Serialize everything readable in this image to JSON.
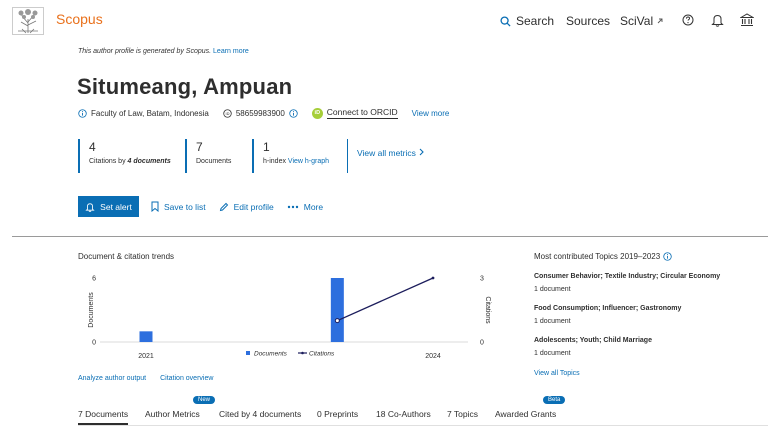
{
  "header": {
    "brand": "Scopus",
    "nav": {
      "search": "Search",
      "sources": "Sources",
      "scival": "SciVal"
    },
    "icons": [
      "elsevier-tree-icon",
      "search-icon",
      "external-link-icon",
      "help-icon",
      "bell-icon",
      "institution-icon"
    ]
  },
  "notice": {
    "text": "This author profile is generated by Scopus.",
    "link": "Learn more"
  },
  "author": {
    "name": "Situmeang, Ampuan",
    "affiliation": "Faculty of Law, Batam, Indonesia",
    "scopus_id": "58659983900",
    "orcid_label": "Connect to ORCID",
    "orcid_badge": "iD",
    "view_more": "View more"
  },
  "metrics": {
    "citations": {
      "value": "4",
      "label": "Citations by",
      "by": "4 documents"
    },
    "documents": {
      "value": "7",
      "label": "Documents"
    },
    "hindex": {
      "value": "1",
      "label": "h-index",
      "link": "View h-graph"
    },
    "view_all": "View all metrics"
  },
  "actions": {
    "set_alert": "Set alert",
    "save_to_list": "Save to list",
    "edit_profile": "Edit profile",
    "more": "More"
  },
  "trends": {
    "title": "Document & citation trends",
    "left_axis_label": "Documents",
    "right_axis_label": "Citations",
    "legend_documents": "Documents",
    "legend_citations": "Citations",
    "links": {
      "analyze": "Analyze author output",
      "overview": "Citation overview"
    }
  },
  "chart_data": {
    "type": "bar",
    "x_tick_labels": [
      "2021",
      "2024"
    ],
    "x": [
      2021,
      2022,
      2023,
      2024
    ],
    "series": [
      {
        "name": "Documents",
        "type": "bar",
        "axis": "left",
        "values": [
          1,
          0,
          6,
          0
        ],
        "color": "#2d6fde"
      },
      {
        "name": "Citations",
        "type": "line",
        "axis": "right",
        "values": [
          null,
          null,
          1,
          3
        ],
        "color": "#1c1d5c"
      }
    ],
    "left_ylim": [
      0,
      6
    ],
    "right_ylim": [
      0,
      3
    ],
    "left_ticks": [
      "6",
      "0"
    ],
    "right_ticks": [
      "3",
      "0"
    ],
    "legend": "bottom-center"
  },
  "topics": {
    "title": "Most contributed Topics 2019–2023",
    "items": [
      {
        "name": "Consumer Behavior; Textile Industry; Circular Economy",
        "count": "1 document"
      },
      {
        "name": "Food Consumption; Influencer; Gastronomy",
        "count": "1 document"
      },
      {
        "name": "Adolescents; Youth; Child Marriage",
        "count": "1 document"
      }
    ],
    "view_all": "View all Topics"
  },
  "tabs": {
    "documents": "7 Documents",
    "author_metrics": "Author Metrics",
    "new_badge": "New",
    "cited_by": "Cited by 4 documents",
    "preprints": "0 Preprints",
    "coauthors": "18 Co-Authors",
    "topics": "7 Topics",
    "grants": "Awarded Grants",
    "beta_badge": "Beta"
  },
  "colors": {
    "accent": "#0a6eb4",
    "brand": "#e9711c",
    "bar": "#2d6fde",
    "line": "#1c1d5c",
    "orcid": "#a6ce39"
  }
}
